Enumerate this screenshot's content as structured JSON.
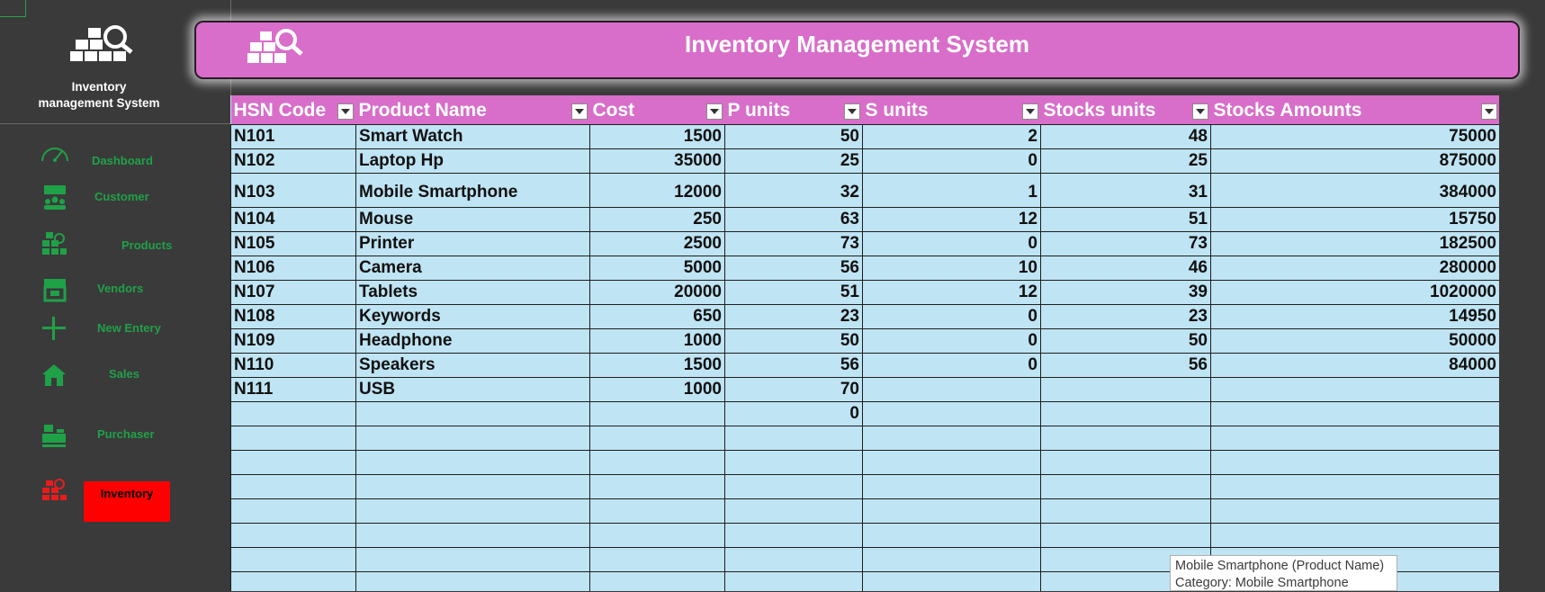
{
  "sidebar": {
    "brand_line1": "Inventory",
    "brand_line2": "management System",
    "items": [
      {
        "label": "Dashboard",
        "icon": "gauge-icon"
      },
      {
        "label": "Customer",
        "icon": "customer-icon"
      },
      {
        "label": "Products",
        "icon": "products-icon"
      },
      {
        "label": "Vendors",
        "icon": "store-icon"
      },
      {
        "label": "New Entery",
        "icon": "plus-icon"
      },
      {
        "label": "Sales",
        "icon": "home-icon"
      },
      {
        "label": "Purchaser",
        "icon": "cash-register-icon"
      },
      {
        "label": "Inventory",
        "icon": "inventory-icon"
      }
    ],
    "active_color": "#ff0000",
    "label_color": "#1fa148"
  },
  "header": {
    "title": "Inventory Management System",
    "bg_color": "#d86ec9"
  },
  "table": {
    "columns": [
      "HSN Code",
      "Product Name",
      "Cost",
      "P units",
      "S units",
      "Stocks units",
      "Stocks Amounts"
    ],
    "rows": [
      [
        "N101",
        "Smart Watch",
        "1500",
        "50",
        "2",
        "48",
        "75000"
      ],
      [
        "N102",
        "Laptop Hp",
        "35000",
        "25",
        "0",
        "25",
        "875000"
      ],
      [
        "N103",
        "Mobile Smartphone",
        "12000",
        "32",
        "1",
        "31",
        "384000"
      ],
      [
        "N104",
        "Mouse",
        "250",
        "63",
        "12",
        "51",
        "15750"
      ],
      [
        "N105",
        "Printer",
        "2500",
        "73",
        "0",
        "73",
        "182500"
      ],
      [
        "N106",
        "Camera",
        "5000",
        "56",
        "10",
        "46",
        "280000"
      ],
      [
        "N107",
        "Tablets",
        "20000",
        "51",
        "12",
        "39",
        "1020000"
      ],
      [
        "N108",
        "Keywords",
        "650",
        "23",
        "0",
        "23",
        "14950"
      ],
      [
        "N109",
        "Headphone",
        "1000",
        "50",
        "0",
        "50",
        "50000"
      ],
      [
        "N110",
        "Speakers",
        "1500",
        "56",
        "0",
        "56",
        "84000"
      ],
      [
        "N111",
        "USB",
        "1000",
        "70",
        "",
        "",
        ""
      ],
      [
        "",
        "",
        "",
        "0",
        "",
        "",
        ""
      ],
      [
        "",
        "",
        "",
        "",
        "",
        "",
        ""
      ],
      [
        "",
        "",
        "",
        "",
        "",
        "",
        ""
      ],
      [
        "",
        "",
        "",
        "",
        "",
        "",
        ""
      ],
      [
        "",
        "",
        "",
        "",
        "",
        "",
        ""
      ],
      [
        "",
        "",
        "",
        "",
        "",
        "",
        ""
      ],
      [
        "",
        "",
        "",
        "",
        "",
        "",
        ""
      ],
      [
        "",
        "",
        "",
        "",
        "",
        "",
        ""
      ]
    ],
    "row_color": "#bfe4f3"
  },
  "tooltip": {
    "line1": "Mobile Smartphone (Product Name)",
    "line2": "Category: Mobile Smartphone"
  }
}
